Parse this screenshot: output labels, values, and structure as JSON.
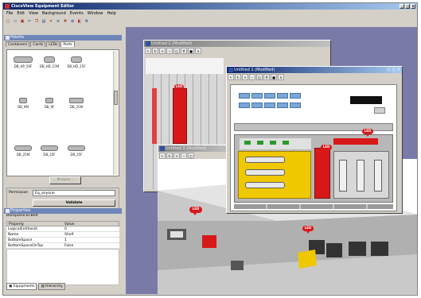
{
  "app": {
    "title": "CiscoView Equipment Editor"
  },
  "menu": [
    "File",
    "Edit",
    "View",
    "Background",
    "Events",
    "Window",
    "Help"
  ],
  "toolbar": [
    "new",
    "open",
    "save",
    "cut",
    "copy",
    "paste",
    "delete",
    "align",
    "grid",
    "zoom",
    "layer",
    "prefs"
  ],
  "palette": {
    "title": "Palette",
    "tabs": [
      "Containers",
      "Cards",
      "LEDs",
      "Ports"
    ],
    "active_tab": "Ports",
    "items": [
      "DB_HP_50F",
      "DB_HD_15M",
      "DB_HD_15F",
      "DB_9M",
      "DB_9F",
      "DB_25M",
      "DB_25M",
      "DB_25F",
      "DB_25F"
    ],
    "button": "Browse..."
  },
  "permission": {
    "label": "Permission",
    "value": "Eq_anyone",
    "button": "Validate"
  },
  "properties": {
    "title": "Properties",
    "subtitle": "Backplane.BTBelt",
    "columns": [
      "Property",
      "Value"
    ],
    "rows": [
      {
        "property": "LogicalEntitiesId",
        "value": "0"
      },
      {
        "property": "Name",
        "value": "Shelf"
      },
      {
        "property": "BottomSpace",
        "value": "1"
      },
      {
        "property": "BottomSpaceOnTop",
        "value": "False"
      }
    ]
  },
  "bottom_tabs": [
    "Equipments",
    "Hierarchy"
  ],
  "windows": {
    "w1": {
      "title": "Untitled 2 (Modified)"
    },
    "w2": {
      "title": "Untitled 1 (Modified)"
    },
    "w3": {
      "title": "Untitled 3 (Modified)"
    }
  },
  "badges": {
    "b1": "LED",
    "b2": "LED",
    "b3": "LED",
    "b4": "LED",
    "b5": "LED",
    "b6": "LED"
  },
  "colors": {
    "accent": "#0a246a",
    "alert_red": "#d81818",
    "canvas": "#7a7aa8",
    "label_yellow": "#f0c800"
  }
}
